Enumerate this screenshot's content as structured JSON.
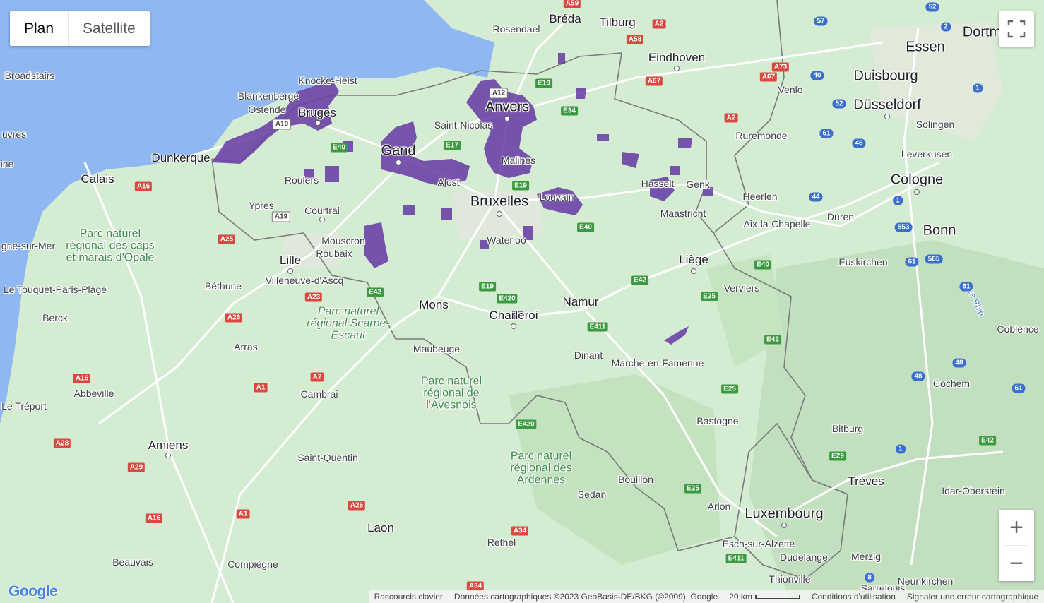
{
  "map_type": {
    "plan": "Plan",
    "satellite": "Satellite"
  },
  "colors": {
    "coverage": "#6a3fa6",
    "sea": "#8fb7f2",
    "land": "#d4ecd2"
  },
  "icons": {
    "fullscreen": "fullscreen-icon",
    "zoom_in": "plus-icon",
    "zoom_out": "minus-icon"
  },
  "controls": {
    "zoom_in": "+",
    "zoom_out": "−"
  },
  "logo": "Google",
  "places": {
    "dortmund": "Dortm",
    "breda": "Bréda",
    "tilburg": "Tilburg",
    "rosendael": "Rosendael",
    "eindhoven": "Eindhoven",
    "essen": "Essen",
    "duisbourg": "Duisbourg",
    "dusseldorf": "Düsseldorf",
    "venlo": "Venlo",
    "solingen": "Solingen",
    "ruremonde": "Ruremonde",
    "leverkusen": "Leverkusen",
    "cologne": "Cologne",
    "heerlen": "Heerlen",
    "duren": "Düren",
    "bonn": "Bonn",
    "aix": "Aix-la-Chapelle",
    "euskirchen": "Euskirchen",
    "broadstairs": "Broadstairs",
    "knocke": "Knocke-Heist",
    "blankenberge": "Blankenberge",
    "ostende": "Ostende",
    "bruges": "Bruges",
    "anvers": "Anvers",
    "saint_nicolas": "Saint-Nicolas",
    "gand": "Gand",
    "malines": "Malines",
    "alost": "Alost",
    "bruxelles": "Bruxelles",
    "louvain": "Louvain",
    "hasselt": "Hasselt",
    "genk": "Genk",
    "maastricht": "Maastricht",
    "dunkerque": "Dunkerque",
    "calais": "Calais",
    "roulers": "Roulers",
    "ypres": "Ypres",
    "courtrai": "Courtrai",
    "mouscron": "Mouscron",
    "roubaix": "Roubaix",
    "lille": "Lille",
    "villeneuve": "Villeneuve-d'Ascq",
    "waterloo": "Waterloo",
    "liege": "Liège",
    "verviers": "Verviers",
    "bethune": "Béthune",
    "boulogne": "gne-sur-Mer",
    "le_touquet": "Le Touquet-Paris-Plage",
    "berck": "Berck",
    "arras": "Arras",
    "mons": "Mons",
    "charleroi": "Charleroi",
    "namur": "Namur",
    "maubeuge": "Maubeuge",
    "dinant": "Dinant",
    "marche": "Marche-en-Famenne",
    "coblence": "Coblence",
    "cochem": "Cochem",
    "cambrai": "Cambrai",
    "abbeville": "Abbeville",
    "le_treport": "Le Tréport",
    "bastogne": "Bastogne",
    "bitburg": "Bitburg",
    "amiens": "Amiens",
    "saint_quentin": "Saint-Quentin",
    "treves": "Trèves",
    "idar": "Idar-Oberstein",
    "bouillon": "Bouillon",
    "sedan": "Sedan",
    "arlon": "Arlon",
    "luxembourg": "Luxembourg",
    "esch": "Esch-sur-Alzette",
    "dudelange": "Dudelange",
    "merzig": "Merzig",
    "laon": "Laon",
    "rethel": "Rethel",
    "beauvais": "Beauvais",
    "compiegne": "Compiègne",
    "thionville": "Thionville",
    "neunkirchen": "Neunkirchen",
    "sarrelouis": "Sarrelouis",
    "vres": "uvres",
    "ine": "ine"
  },
  "parks": {
    "opale": "Parc naturel régional des caps et marais d'Opale",
    "scarpe": "Parc naturel régional Scarpe-Escaut",
    "avesnois": "Parc naturel régional de l'Avesnois",
    "ardennes": "Parc naturel régional des Ardennes"
  },
  "river": "Le Rhin",
  "shields": {
    "a59": "A59",
    "a2_nl": "A2",
    "a58": "A58",
    "a67": "A67",
    "a73": "A73",
    "e19_nl": "E19",
    "e34": "E34",
    "a12": "A12",
    "a10": "A10",
    "e40_w": "E40",
    "e17": "E17",
    "e19": "E19",
    "a16": "A16",
    "a19": "A19",
    "a25": "A25",
    "e40": "E40",
    "e42": "E42",
    "e19_s": "E19",
    "e420": "E420",
    "a23": "A23",
    "a26": "A26",
    "e411": "E411",
    "e42_e": "E42",
    "e25": "E25",
    "e40_e": "E40",
    "a2_nl2": "A2",
    "e25_s": "E25",
    "e42_far": "E42",
    "a2_fr": "A2",
    "a1": "A1",
    "a16_s": "A16",
    "e420_s": "E420",
    "a28": "A28",
    "a29": "A29",
    "e25_lux": "E25",
    "e29": "E29",
    "e42_de": "E42",
    "a26_s": "A26",
    "a1_s": "A1",
    "a16_s2": "A16",
    "a34": "A34",
    "e411_s": "E411",
    "a34_s": "A34",
    "b52": "52",
    "b57": "57",
    "b2": "2",
    "b40": "40",
    "b1": "1",
    "b52b": "52",
    "b61": "61",
    "b46": "46",
    "b44": "44",
    "b1b": "1",
    "b553": "553",
    "b61b": "61",
    "b565": "565",
    "b61c": "61",
    "b48": "48",
    "b48b": "48",
    "b61d": "61",
    "b1c": "1",
    "b8": "8"
  },
  "footer": {
    "shortcuts": "Raccourcis clavier",
    "data": "Données cartographiques ©2023 GeoBasis-DE/BKG (©2009), Google",
    "scale": "20 km",
    "terms": "Conditions d'utilisation",
    "report": "Signaler une erreur cartographique"
  }
}
